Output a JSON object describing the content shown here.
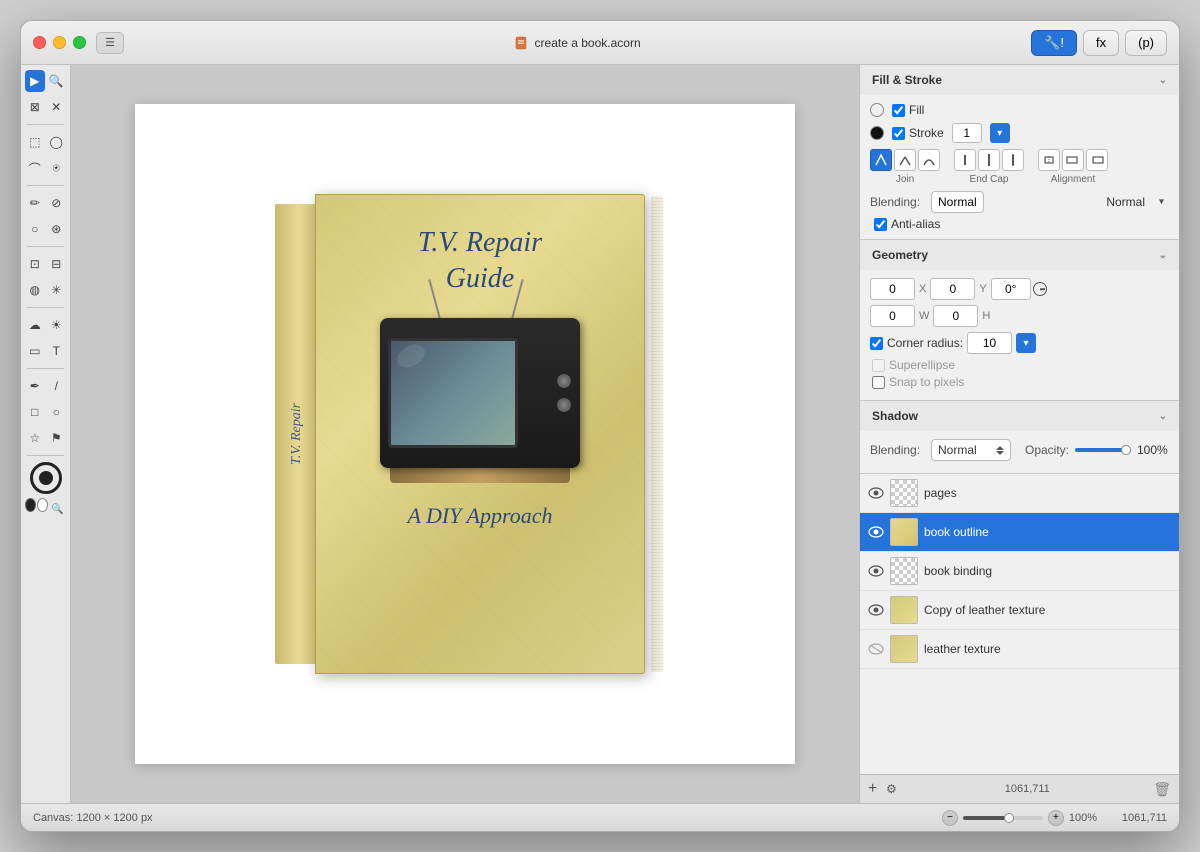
{
  "window": {
    "title": "create a book.acorn",
    "canvas_size": "Canvas: 1200 × 1200 px",
    "zoom": "100%",
    "coordinates": "1061,711"
  },
  "titlebar": {
    "traffic_lights": [
      "close",
      "minimize",
      "maximize"
    ],
    "sidebar_btn": "☰",
    "tabs": [
      {
        "label": "🔧!",
        "id": "tools",
        "active": true
      },
      {
        "label": "fx",
        "id": "effects",
        "active": false
      },
      {
        "label": "(p)",
        "id": "type",
        "active": false
      }
    ]
  },
  "fill_stroke": {
    "title": "Fill & Stroke",
    "fill_label": "Fill",
    "fill_checked": true,
    "stroke_label": "Stroke",
    "stroke_checked": true,
    "stroke_value": "1",
    "join": {
      "label": "Join",
      "buttons": [
        "⌒",
        "⌒",
        "⌒"
      ]
    },
    "end_cap": {
      "label": "End Cap",
      "buttons": [
        "⊓",
        "⊓",
        "⊓"
      ]
    },
    "alignment": {
      "label": "Alignment",
      "buttons": [
        "⊣",
        "⊢",
        "⊣"
      ]
    },
    "blending_label": "Blending:",
    "blending_value": "Normal",
    "antialias_label": "Anti-alias"
  },
  "geometry": {
    "title": "Geometry",
    "x_label": "X",
    "y_label": "Y",
    "x_value": "0",
    "y_value": "0",
    "angle_value": "0°",
    "w_label": "W",
    "h_label": "H",
    "w_value": "0",
    "h_value": "0",
    "corner_radius_label": "Corner radius:",
    "corner_radius_value": "10",
    "corner_checked": true,
    "superellipse_label": "Superellipse",
    "snap_label": "Snap to pixels"
  },
  "shadow": {
    "title": "Shadow",
    "blending_label": "Blending:",
    "blending_value": "Normal",
    "opacity_label": "Opacity:",
    "opacity_value": "100%"
  },
  "layers": {
    "items": [
      {
        "name": "pages",
        "visible": true,
        "selected": false,
        "thumb": "checkered",
        "eye_hidden": false
      },
      {
        "name": "book outline",
        "visible": true,
        "selected": true,
        "thumb": "book-outline",
        "eye_hidden": false
      },
      {
        "name": "book binding",
        "visible": true,
        "selected": false,
        "thumb": "checkered",
        "eye_hidden": false
      },
      {
        "name": "Copy of leather texture",
        "visible": true,
        "selected": false,
        "thumb": "golden",
        "eye_hidden": false
      },
      {
        "name": "leather texture",
        "visible": false,
        "selected": false,
        "thumb": "golden",
        "eye_hidden": true
      }
    ],
    "add_label": "+",
    "settings_label": "⚙",
    "coord_label": "1061,711",
    "trash_label": "🗑"
  },
  "book": {
    "title_line1": "T.V. Repair",
    "title_line2": "Guide",
    "subtitle": "A DIY Approach",
    "spine_text": "T.V. Repair"
  },
  "status": {
    "canvas_info": "Canvas: 1200 × 1200 px",
    "zoom_pct": "100%",
    "coordinates": "1061,711"
  },
  "icons": {
    "arrow": "▶",
    "zoom_in": "+",
    "zoom_out": "−",
    "chevron_down": "⌄",
    "eye": "●",
    "eye_closed": "○",
    "gear": "⚙",
    "trash": "⌫",
    "plus": "+"
  }
}
